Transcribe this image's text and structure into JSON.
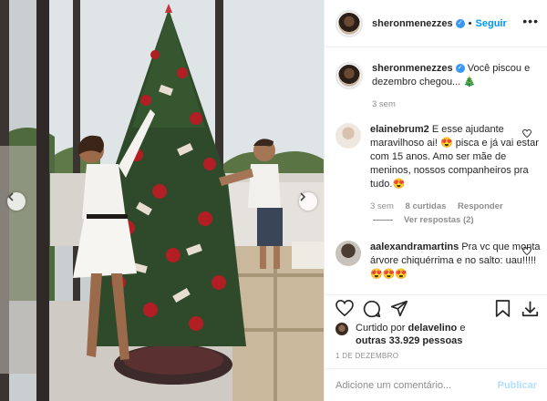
{
  "post": {
    "author": "sheronmenezzes",
    "follow_label": "Seguir",
    "separator": "•",
    "more_label": "•••"
  },
  "caption": {
    "username": "sheronmenezzes",
    "text": "Você piscou e dezembro chegou... 🎄",
    "time": "3 sem"
  },
  "comments": [
    {
      "username": "elainebrum2",
      "text": "E esse ajudante maravilhoso ai! 😍 pisca e já vai estar com 15 anos. Amo ser mãe de meninos, nossos companheiros pra tudo.😍",
      "time": "3 sem",
      "likes": "8 curtidas",
      "reply_label": "Responder",
      "view_replies": "Ver respostas (2)"
    },
    {
      "username": "aalexandramartins",
      "text": "Pra vc que monta árvore chiquérrima e no salto: uau!!!!!😍😍😍"
    }
  ],
  "likes": {
    "prefix": "Curtido por",
    "user": "delavelino",
    "conjunction": "e",
    "count_text": "outras 33.929 pessoas"
  },
  "date": "1 DE DEZEMBRO",
  "add_comment": {
    "placeholder": "Adicione um comentário...",
    "publish_label": "Publicar"
  },
  "icons": [
    "chevron-left-icon",
    "chevron-right-icon",
    "heart-icon",
    "comment-icon",
    "share-icon",
    "bookmark-icon",
    "download-icon",
    "verified-icon"
  ],
  "colors": {
    "link": "#0095f6",
    "verified": "#3897f0",
    "muted": "#8e8e8e",
    "publish_disabled": "#b2dffc"
  }
}
